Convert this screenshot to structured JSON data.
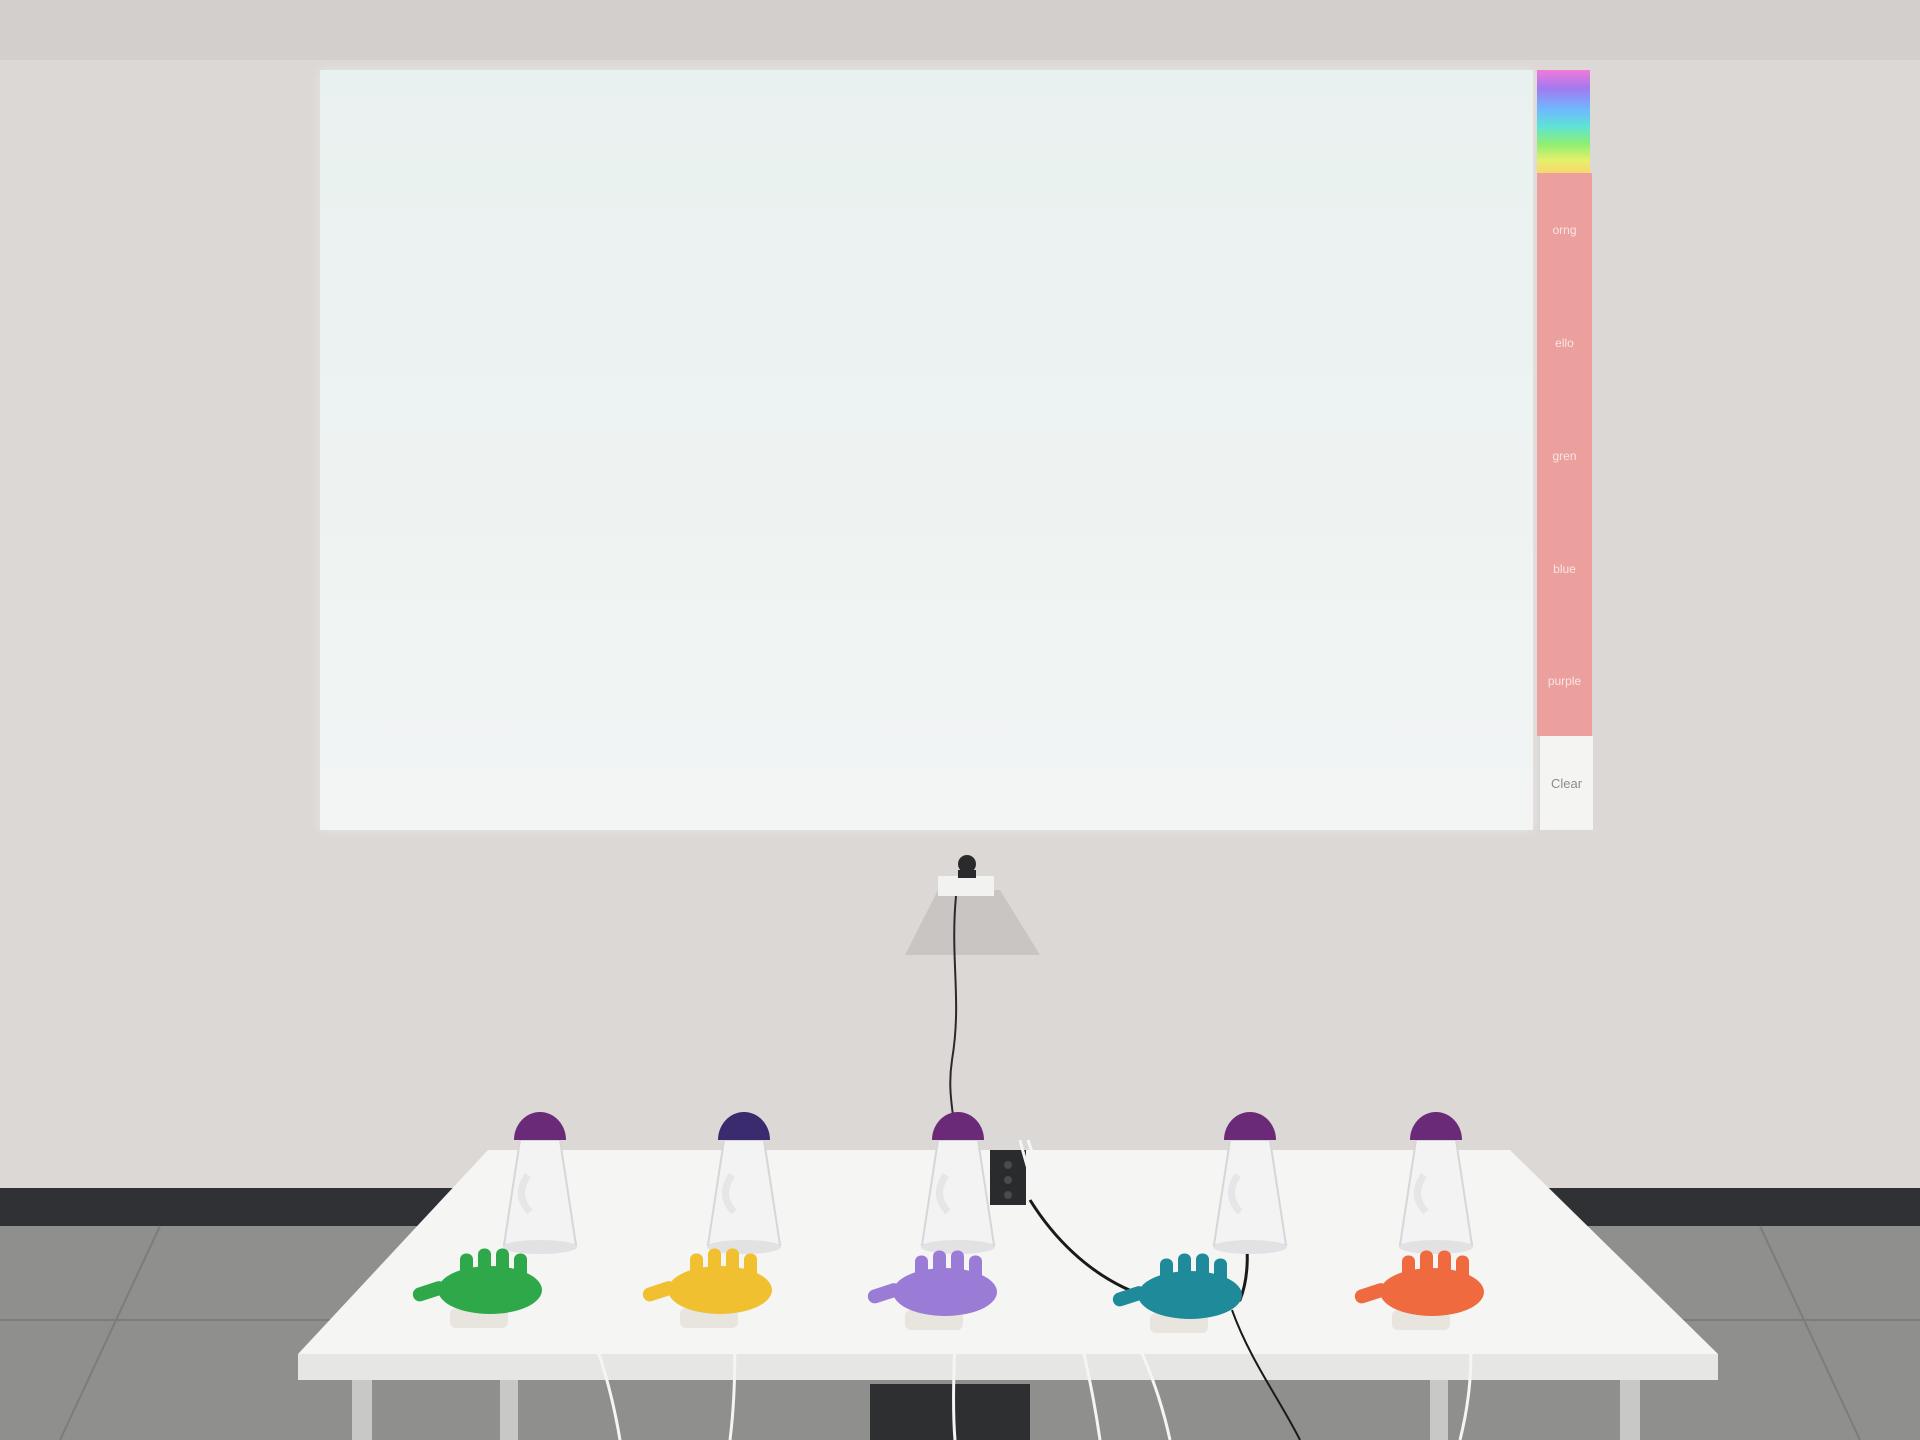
{
  "projection": {
    "palette_buttons": [
      {
        "label": "orng"
      },
      {
        "label": "ello"
      },
      {
        "label": "gren"
      },
      {
        "label": "blue"
      },
      {
        "label": "purple"
      }
    ],
    "clear_label": "Clear"
  },
  "colors": {
    "palette_panel": "#eba09d",
    "canvas": "#eef3f2",
    "wall": "#dcd8d6",
    "table": "#f5f5f4"
  },
  "props": {
    "megaphone_caps": [
      "#6b2a78",
      "#3a2a6e",
      "#6b2a78",
      "#6b2a78",
      "#6b2a78"
    ],
    "glove_colors": [
      "#2fa84a",
      "#f0c030",
      "#9a7cd6",
      "#1f8a9a",
      "#f06a40"
    ]
  }
}
